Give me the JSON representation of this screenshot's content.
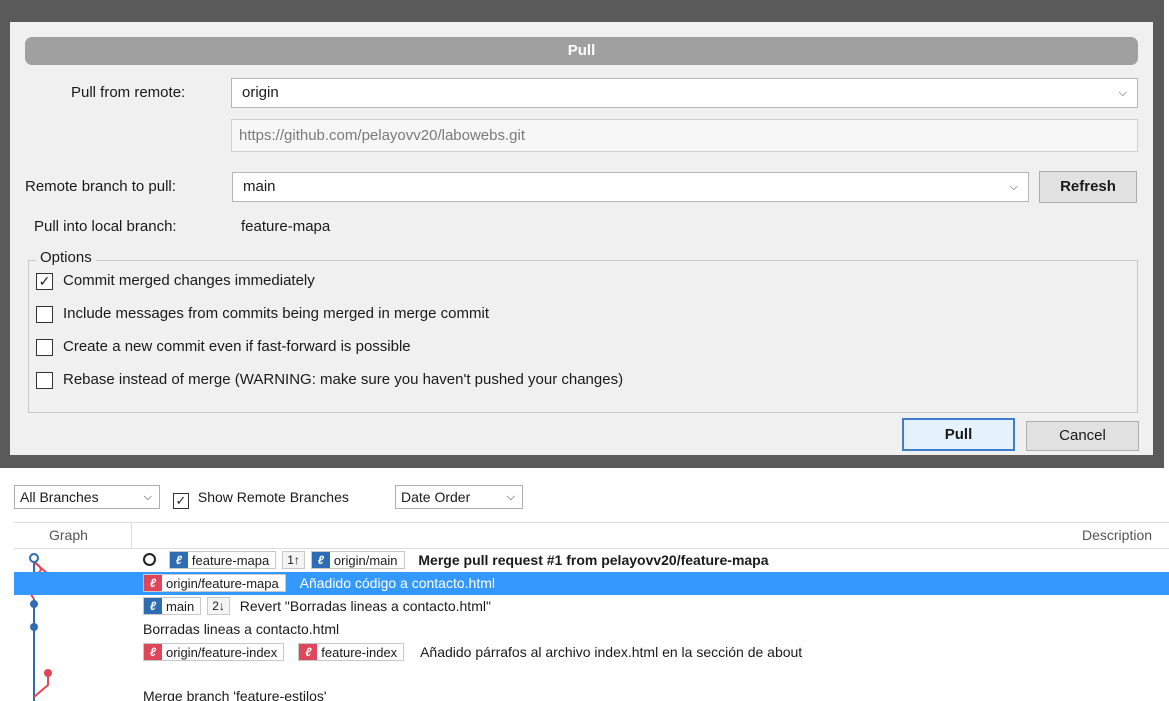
{
  "dialog": {
    "title": "Pull",
    "pull_from_remote_label": "Pull from remote:",
    "remote_value": "origin",
    "remote_url": "https://github.com/pelayovv20/labowebs.git",
    "remote_branch_label": "Remote branch to pull:",
    "remote_branch_value": "main",
    "refresh_label": "Refresh",
    "local_branch_label": "Pull into local branch:",
    "local_branch_value": "feature-mapa",
    "options_label": "Options",
    "options": [
      {
        "label": "Commit merged changes immediately",
        "checked": true
      },
      {
        "label": "Include messages from commits being merged in merge commit",
        "checked": false
      },
      {
        "label": "Create a new commit even if fast-forward is possible",
        "checked": false
      },
      {
        "label": "Rebase instead of merge (WARNING: make sure you haven't pushed your changes)",
        "checked": false
      }
    ],
    "pull_button": "Pull",
    "cancel_button": "Cancel"
  },
  "log": {
    "branches_filter": "All Branches",
    "show_remote_label": "Show Remote Branches",
    "show_remote_checked": true,
    "order_filter": "Date Order",
    "col_graph": "Graph",
    "col_description": "Description",
    "rows": [
      {
        "refs": [
          {
            "name": "feature-mapa",
            "color": "blue",
            "count": "1↑"
          },
          {
            "name": "origin/main",
            "color": "blue"
          }
        ],
        "message": "Merge pull request #1 from pelayovv20/feature-mapa",
        "head": true,
        "bold": true
      },
      {
        "refs": [
          {
            "name": "origin/feature-mapa",
            "color": "red"
          }
        ],
        "message": "Añadido código a contacto.html",
        "selected": true
      },
      {
        "refs": [
          {
            "name": "main",
            "color": "blue",
            "count": "2↓"
          }
        ],
        "message": "Revert \"Borradas lineas a contacto.html\""
      },
      {
        "refs": [],
        "message": "Borradas lineas a contacto.html"
      },
      {
        "refs": [
          {
            "name": "origin/feature-index",
            "color": "red"
          },
          {
            "name": "feature-index",
            "color": "red"
          }
        ],
        "message": "Añadido párrafos al archivo index.html en la sección de about"
      },
      {
        "refs": [],
        "message": "Merge branch 'feature-estilos'"
      }
    ]
  },
  "icons": {
    "branch": "branch-icon",
    "chevron": "chevron-down-icon",
    "check": "checkmark-icon"
  },
  "colors": {
    "graph_blue": "#2e6db4",
    "graph_red": "#e0465a",
    "selection": "#3399ff",
    "default_button_border": "#3c7fd1"
  }
}
